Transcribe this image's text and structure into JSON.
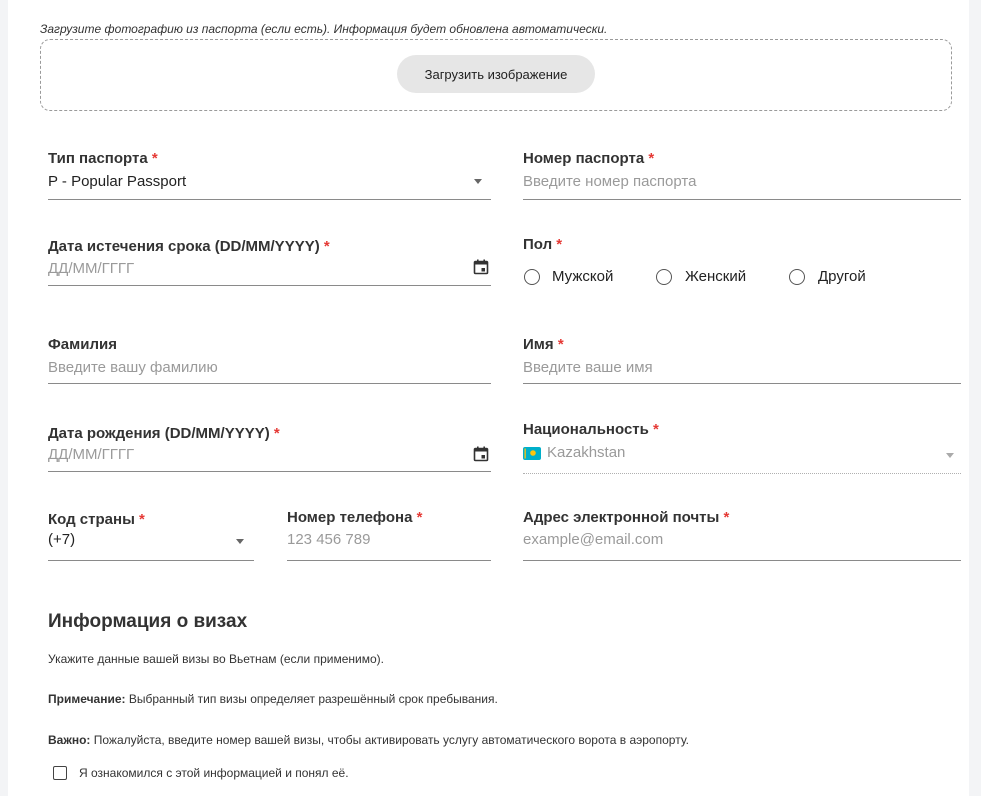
{
  "upload": {
    "hint": "Загрузите фотографию из паспорта (если есть). Информация будет обновлена автоматически.",
    "button_label": "Загрузить изображение"
  },
  "fields": {
    "passport_type": {
      "label": "Тип паспорта",
      "required_mark": "*",
      "value": "P - Popular Passport"
    },
    "passport_number": {
      "label": "Номер паспорта",
      "required_mark": "*",
      "placeholder": "Введите номер паспорта"
    },
    "expiry_date": {
      "label": "Дата истечения срока (DD/MM/YYYY)",
      "required_mark": "*",
      "placeholder": "ДД/ММ/ГГГГ",
      "icon": "calendar-icon"
    },
    "gender": {
      "label": "Пол",
      "required_mark": "*",
      "options": [
        "Мужской",
        "Женский",
        "Другой"
      ]
    },
    "last_name": {
      "label": "Фамилия",
      "placeholder": "Введите вашу фамилию"
    },
    "first_name": {
      "label": "Имя",
      "required_mark": "*",
      "placeholder": "Введите ваше имя"
    },
    "birth_date": {
      "label": "Дата рождения (DD/MM/YYYY)",
      "required_mark": "*",
      "placeholder": "ДД/ММ/ГГГГ",
      "icon": "calendar-icon"
    },
    "nationality": {
      "label": "Национальность",
      "required_mark": "*",
      "value": "Kazakhstan",
      "flag": "kazakhstan-flag-icon"
    },
    "country_code": {
      "label": "Код страны",
      "required_mark": "*",
      "value": "(+7)"
    },
    "phone": {
      "label": "Номер телефона",
      "required_mark": "*",
      "placeholder": "123 456 789"
    },
    "email": {
      "label": "Адрес электронной почты",
      "required_mark": "*",
      "placeholder": "example@email.com"
    }
  },
  "visa": {
    "title": "Информация о визах",
    "intro": "Укажите данные вашей визы во Вьетнам (если применимо).",
    "note_bold": "Примечание:",
    "note_text": " Выбранный тип визы определяет разрешённый срок пребывания.",
    "important_bold": "Важно:",
    "important_text": " Пожалуйста, введите номер вашей визы, чтобы активировать услугу автоматического ворота в аэропорту.",
    "ack_label": "Я ознакомился с этой информацией и понял её."
  },
  "colors": {
    "required": "#e53935",
    "kazakhstan_flag": "#00afca",
    "kazakhstan_sun": "#fec50c"
  }
}
